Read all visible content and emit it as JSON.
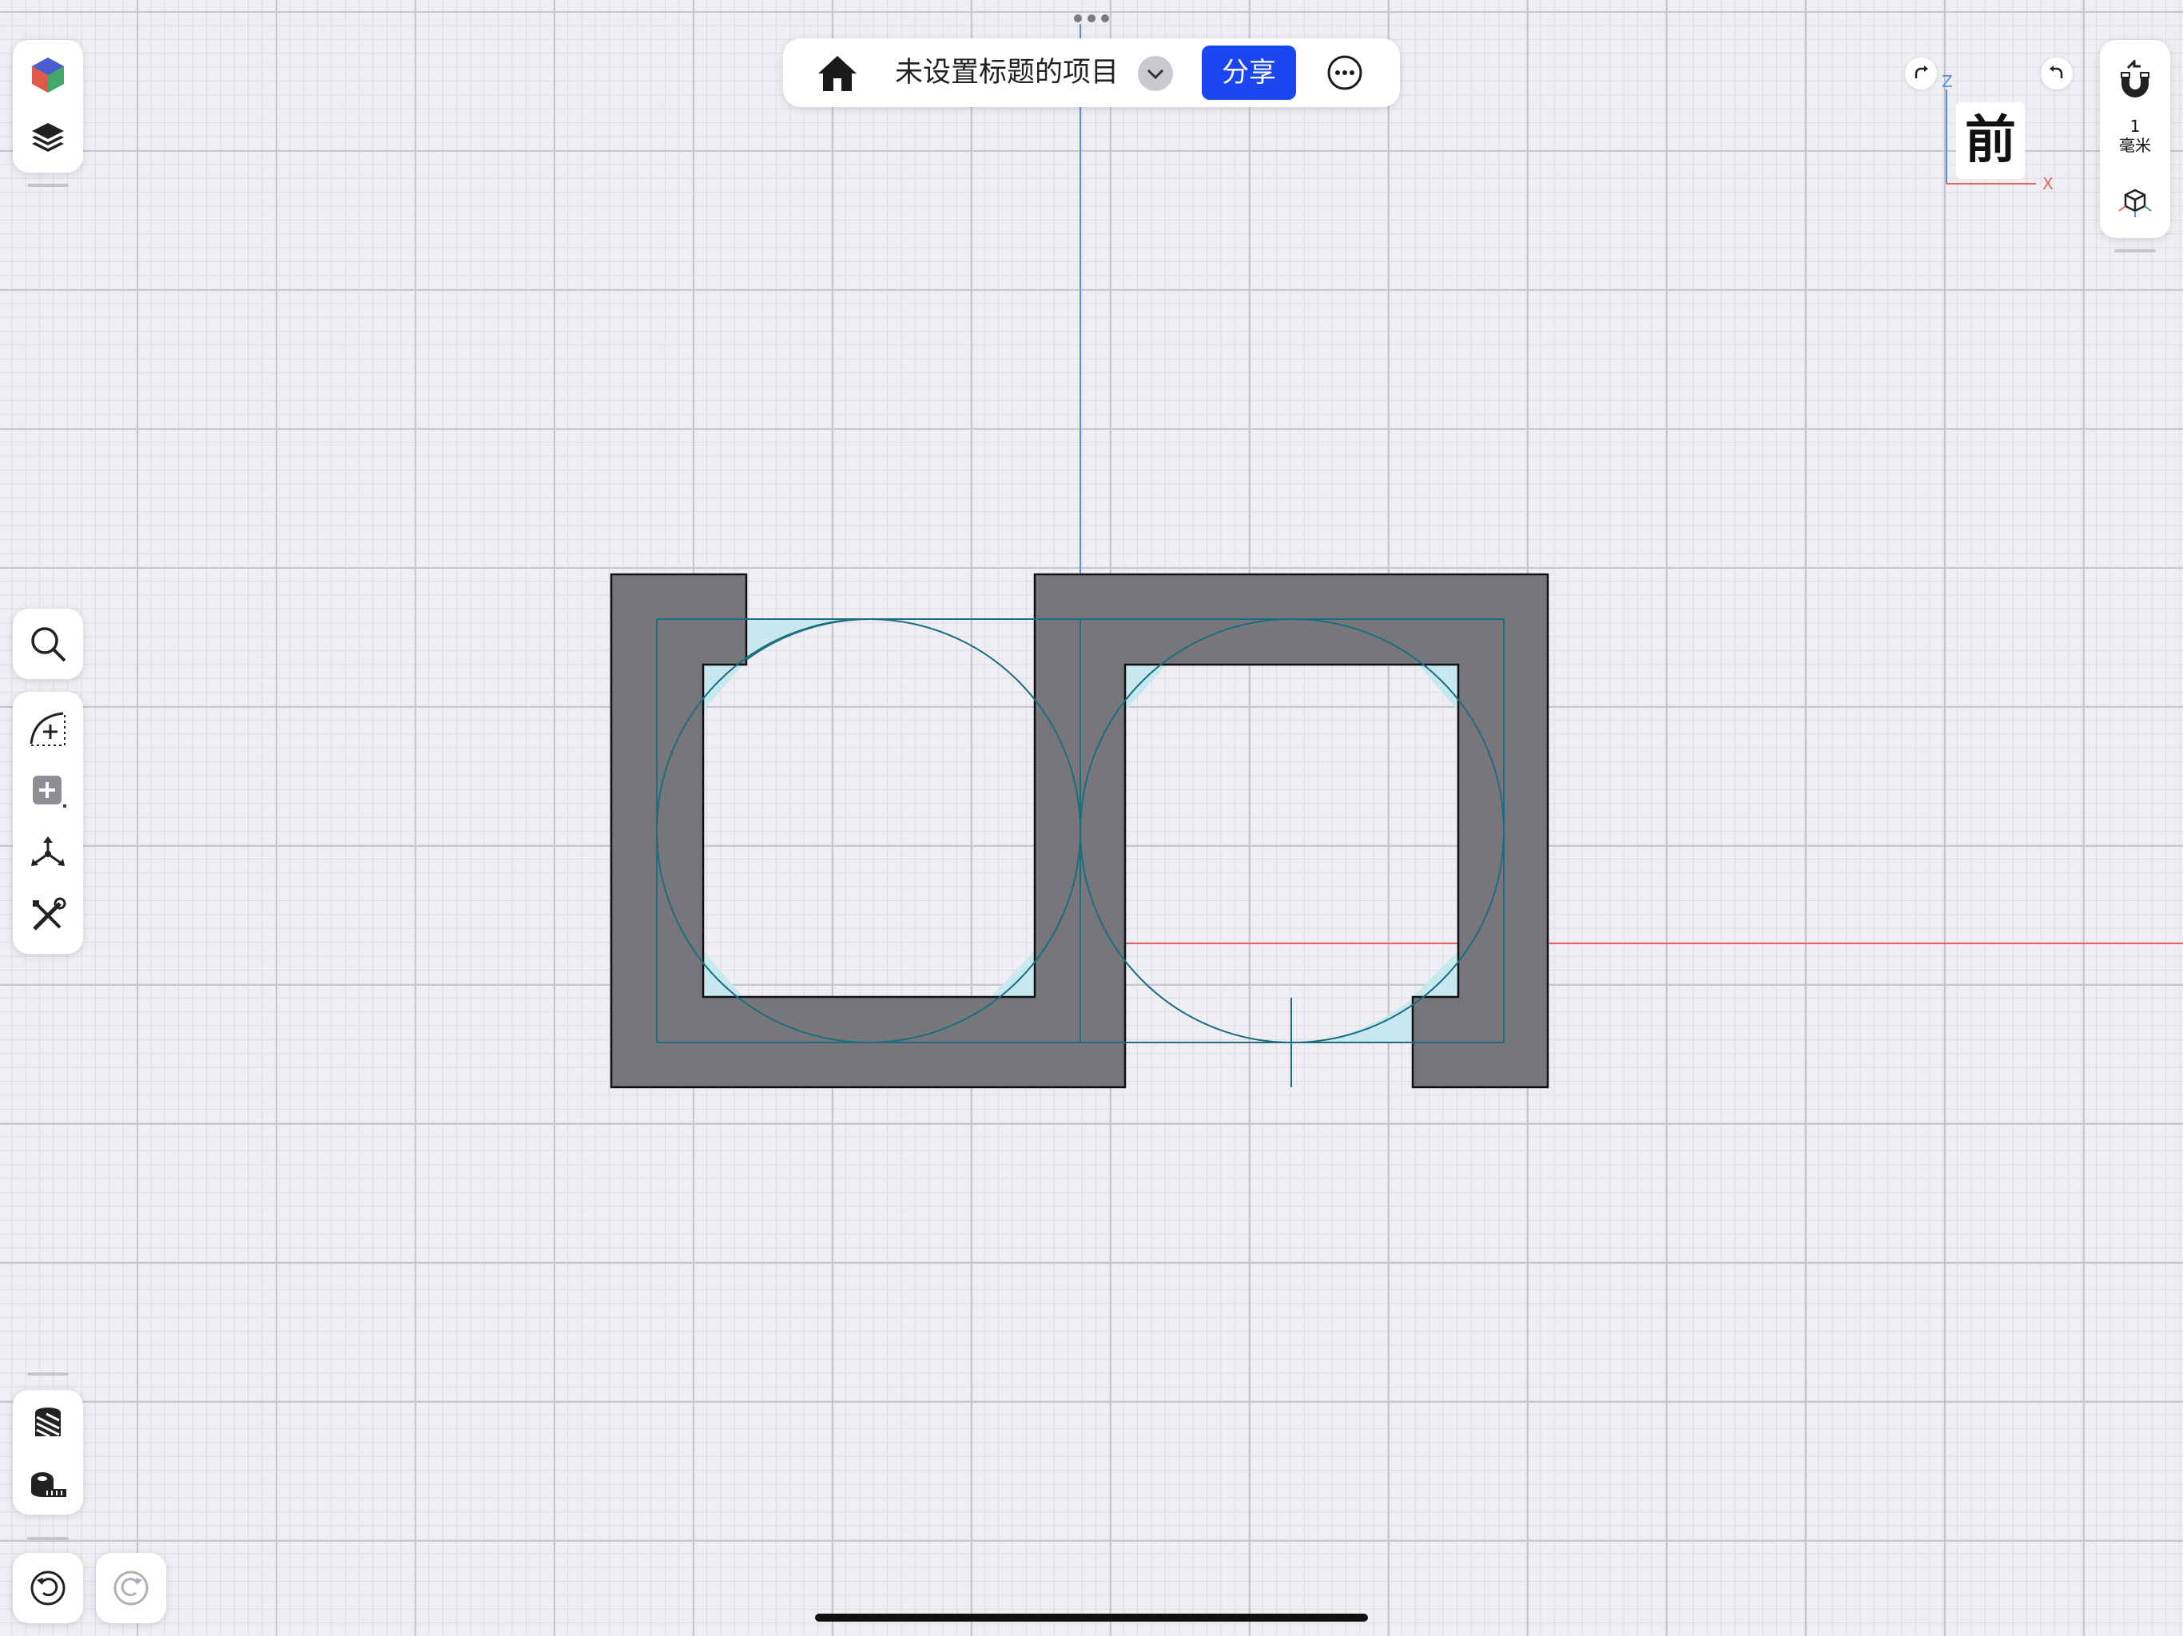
{
  "app": {
    "project_title": "未设置标题的项目",
    "share_label": "分享"
  },
  "view_cube": {
    "label": "前",
    "axis_z": "Z",
    "axis_x": "X"
  },
  "snap": {
    "value": "1",
    "unit": "毫米"
  },
  "colors": {
    "share": "#1b47f2",
    "shape_fill": "#77777b",
    "sketch_line": "#1a6e80",
    "sketch_fill": "#c8e8ef",
    "axis_x": "#e86060",
    "axis_z": "#5a8ee6"
  },
  "icons": {
    "top_left": [
      "cube-icon",
      "layers-icon"
    ],
    "tools": [
      "search-icon",
      "sketch-icon",
      "add-primitive-icon",
      "transform-icon",
      "modify-icon"
    ],
    "bottom": [
      "material-icon",
      "measure-icon",
      "undo-icon",
      "redo-icon"
    ],
    "right": [
      "magnet-icon",
      "view-cube-icon"
    ]
  }
}
